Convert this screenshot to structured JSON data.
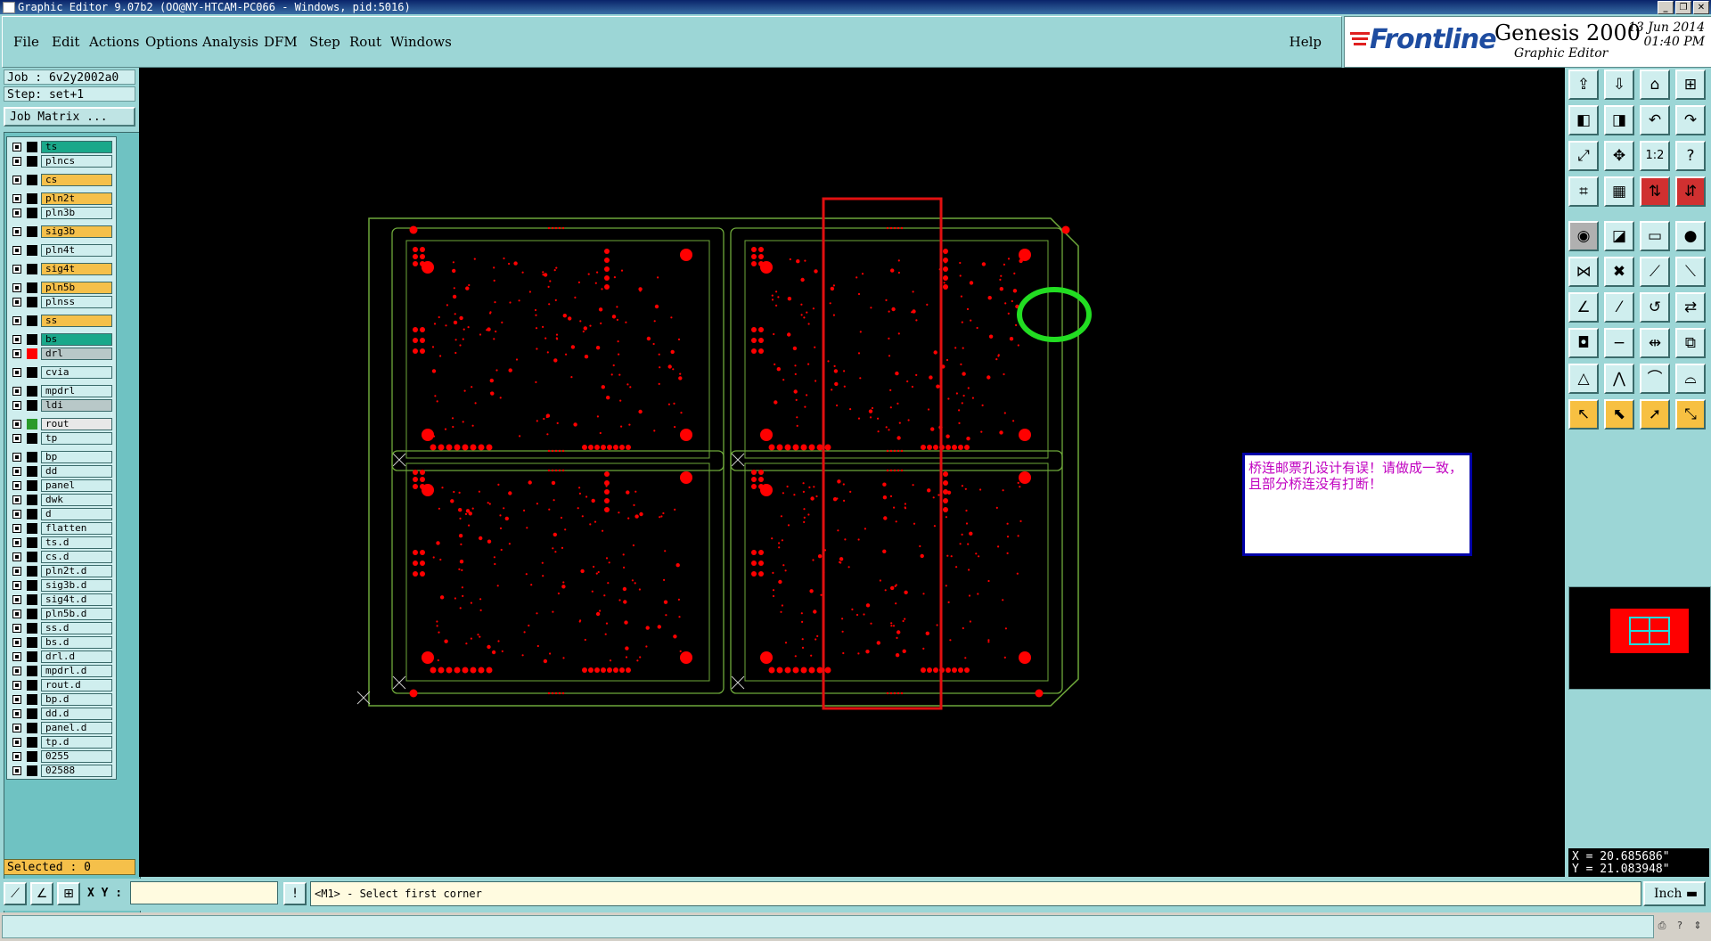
{
  "window": {
    "title": "Graphic Editor 9.07b2 (OO@NY-HTCAM-PC066 - Windows, pid:5016)",
    "controls": [
      "_",
      "❐",
      "✕"
    ]
  },
  "menu": {
    "items": [
      "File",
      "Edit",
      "Actions",
      "Options",
      "Analysis",
      "DFM",
      "Step",
      "Rout",
      "Windows"
    ],
    "help": "Help"
  },
  "brand": {
    "logo": "Frontline",
    "product": "Genesis 2000",
    "subtitle": "Graphic Editor",
    "date": "13 Jun 2014",
    "time": "01:40 PM"
  },
  "left": {
    "job": "Job : 6v2y2002a0",
    "step": "Step: set+1",
    "job_matrix": "Job Matrix ...",
    "selected": "Selected : 0"
  },
  "layers": [
    {
      "name": "ts",
      "bg": "#1aa88a",
      "sw": "#000000"
    },
    {
      "name": "plncs",
      "bg": "#cfeeee",
      "sw": "#000000"
    },
    {
      "name": "cs",
      "bg": "#f5c04a",
      "sw": "#000000"
    },
    {
      "name": "pln2t",
      "bg": "#f5c04a",
      "sw": "#000000"
    },
    {
      "name": "pln3b",
      "bg": "#cfeeee",
      "sw": "#000000"
    },
    {
      "name": "sig3b",
      "bg": "#f5c04a",
      "sw": "#000000"
    },
    {
      "name": "pln4t",
      "bg": "#cfeeee",
      "sw": "#000000"
    },
    {
      "name": "sig4t",
      "bg": "#f5c04a",
      "sw": "#000000"
    },
    {
      "name": "pln5b",
      "bg": "#f5c04a",
      "sw": "#000000"
    },
    {
      "name": "plnss",
      "bg": "#cfeeee",
      "sw": "#000000"
    },
    {
      "name": "ss",
      "bg": "#f5c04a",
      "sw": "#000000"
    },
    {
      "name": "bs",
      "bg": "#1aa88a",
      "sw": "#000000"
    },
    {
      "name": "drl",
      "bg": "#b8c8c8",
      "sw": "#ff0000"
    },
    {
      "name": "cvia",
      "bg": "#cfeeee",
      "sw": "#000000"
    },
    {
      "name": "mpdrl",
      "bg": "#cfeeee",
      "sw": "#000000"
    },
    {
      "name": "ldi",
      "bg": "#b8c8c8",
      "sw": "#000000"
    },
    {
      "name": "rout",
      "bg": "#e8e8e8",
      "sw": "#2a9a2a"
    },
    {
      "name": "tp",
      "bg": "#cfeeee",
      "sw": "#000000"
    },
    {
      "name": "bp",
      "bg": "#cfeeee",
      "sw": "#000000"
    },
    {
      "name": "dd",
      "bg": "#cfeeee",
      "sw": "#000000"
    },
    {
      "name": "panel",
      "bg": "#cfeeee",
      "sw": "#000000"
    },
    {
      "name": "dwk",
      "bg": "#cfeeee",
      "sw": "#000000"
    },
    {
      "name": "d",
      "bg": "#cfeeee",
      "sw": "#000000"
    },
    {
      "name": "flatten",
      "bg": "#cfeeee",
      "sw": "#000000"
    },
    {
      "name": "ts.d",
      "bg": "#cfeeee",
      "sw": "#000000"
    },
    {
      "name": "cs.d",
      "bg": "#cfeeee",
      "sw": "#000000"
    },
    {
      "name": "pln2t.d",
      "bg": "#cfeeee",
      "sw": "#000000"
    },
    {
      "name": "sig3b.d",
      "bg": "#cfeeee",
      "sw": "#000000"
    },
    {
      "name": "sig4t.d",
      "bg": "#cfeeee",
      "sw": "#000000"
    },
    {
      "name": "pln5b.d",
      "bg": "#cfeeee",
      "sw": "#000000"
    },
    {
      "name": "ss.d",
      "bg": "#cfeeee",
      "sw": "#000000"
    },
    {
      "name": "bs.d",
      "bg": "#cfeeee",
      "sw": "#000000"
    },
    {
      "name": "drl.d",
      "bg": "#cfeeee",
      "sw": "#000000"
    },
    {
      "name": "mpdrl.d",
      "bg": "#cfeeee",
      "sw": "#000000"
    },
    {
      "name": "rout.d",
      "bg": "#cfeeee",
      "sw": "#000000"
    },
    {
      "name": "bp.d",
      "bg": "#cfeeee",
      "sw": "#000000"
    },
    {
      "name": "dd.d",
      "bg": "#cfeeee",
      "sw": "#000000"
    },
    {
      "name": "panel.d",
      "bg": "#cfeeee",
      "sw": "#000000"
    },
    {
      "name": "tp.d",
      "bg": "#cfeeee",
      "sw": "#000000"
    },
    {
      "name": "0255",
      "bg": "#cfeeee",
      "sw": "#000000"
    },
    {
      "name": "02588",
      "bg": "#cfeeee",
      "sw": "#000000"
    }
  ],
  "canvas": {
    "note": "桥连邮票孔设计有误！请做成一致，且部分桥连没有打断！",
    "board_color": "#6ea83a",
    "pad_color": "#ff0000",
    "highlight_rect_color": "#e01010",
    "highlight_circle_color": "#22dd22"
  },
  "toolbar": {
    "icons": [
      {
        "name": "open-job-icon",
        "g": "⇪",
        "style": ""
      },
      {
        "name": "save-icon",
        "g": "⇩",
        "style": ""
      },
      {
        "name": "home-icon",
        "g": "⌂",
        "style": ""
      },
      {
        "name": "window-layout-icon",
        "g": "⊞",
        "style": ""
      },
      {
        "name": "pan-left-icon",
        "g": "◧",
        "style": ""
      },
      {
        "name": "pan-right-icon",
        "g": "◨",
        "style": ""
      },
      {
        "name": "undo-icon",
        "g": "↶",
        "style": ""
      },
      {
        "name": "redo-icon",
        "g": "↷",
        "style": ""
      },
      {
        "name": "zoom-fit-icon",
        "g": "⤢",
        "style": ""
      },
      {
        "name": "zoom-center-icon",
        "g": "✥",
        "style": ""
      },
      {
        "name": "scale-icon",
        "g": "1:2",
        "style": ""
      },
      {
        "name": "query-icon",
        "g": "?",
        "style": ""
      },
      {
        "name": "measure-icon",
        "g": "⌗",
        "style": ""
      },
      {
        "name": "grid-icon",
        "g": "▦",
        "style": ""
      },
      {
        "name": "snap-icon",
        "g": "⇅",
        "style": "red"
      },
      {
        "name": "snap-alt-icon",
        "g": "⇵",
        "style": "red"
      },
      {
        "name": "snapshot-icon",
        "g": "◉",
        "style": "dark"
      },
      {
        "name": "shape-icon",
        "g": "◪",
        "style": ""
      },
      {
        "name": "ruler-icon",
        "g": "▭",
        "style": ""
      },
      {
        "name": "pad-icon",
        "g": "●",
        "style": ""
      },
      {
        "name": "connect-icon",
        "g": "⋈",
        "style": ""
      },
      {
        "name": "cross-icon",
        "g": "✖",
        "style": ""
      },
      {
        "name": "line-add-icon",
        "g": "⟋",
        "style": ""
      },
      {
        "name": "line-move-icon",
        "g": "⟍",
        "style": ""
      },
      {
        "name": "angle-icon",
        "g": "∠",
        "style": ""
      },
      {
        "name": "slash-icon",
        "g": "⁄",
        "style": ""
      },
      {
        "name": "arc-icon",
        "g": "↺",
        "style": ""
      },
      {
        "name": "flip-icon",
        "g": "⇄",
        "style": ""
      },
      {
        "name": "pad-move-icon",
        "g": "◘",
        "style": ""
      },
      {
        "name": "minus-icon",
        "g": "−",
        "style": ""
      },
      {
        "name": "resize-icon",
        "g": "⇹",
        "style": ""
      },
      {
        "name": "group-icon",
        "g": "⧉",
        "style": ""
      },
      {
        "name": "triangle-icon",
        "g": "△",
        "style": ""
      },
      {
        "name": "peak-icon",
        "g": "⋀",
        "style": ""
      },
      {
        "name": "arch-icon",
        "g": "⌒",
        "style": ""
      },
      {
        "name": "hill-icon",
        "g": "⌓",
        "style": ""
      },
      {
        "name": "select-icon",
        "g": "↖",
        "style": "yel"
      },
      {
        "name": "select-box-icon",
        "g": "⬉",
        "style": "yel"
      },
      {
        "name": "select-pick-icon",
        "g": "➚",
        "style": "yel"
      },
      {
        "name": "select-net-icon",
        "g": "⤡",
        "style": "yel"
      }
    ]
  },
  "coords": {
    "x": "X = 20.685686\"",
    "y": "Y = 21.083948\""
  },
  "status": {
    "xy_label": "X Y :",
    "xy_value": "",
    "message": "<M1> - Select first corner",
    "units": "Inch"
  }
}
